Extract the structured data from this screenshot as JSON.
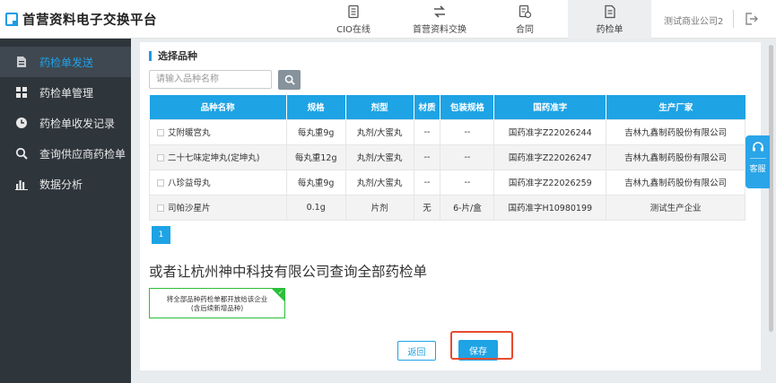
{
  "header": {
    "title": "首营资料电子交换平台",
    "tabs": [
      {
        "label": "CIO在线",
        "icon": "document-icon"
      },
      {
        "label": "首营资料交换",
        "icon": "exchange-icon"
      },
      {
        "label": "合同",
        "icon": "contract-icon"
      },
      {
        "label": "药检单",
        "icon": "report-icon"
      }
    ],
    "company": "测试商业公司2",
    "logout_icon": "logout-icon"
  },
  "sidebar": {
    "items": [
      {
        "label": "药检单发送",
        "icon": "document-icon"
      },
      {
        "label": "药检单管理",
        "icon": "grid-icon"
      },
      {
        "label": "药检单收发记录",
        "icon": "clock-icon"
      },
      {
        "label": "查询供应商药检单",
        "icon": "search-icon"
      },
      {
        "label": "数据分析",
        "icon": "bar-chart-icon"
      }
    ]
  },
  "main": {
    "section_title": "选择品种",
    "search": {
      "placeholder": "请输入品种名称",
      "value": ""
    },
    "table": {
      "columns": [
        "品种名称",
        "规格",
        "剂型",
        "材质",
        "包装规格",
        "国药准字",
        "生产厂家"
      ],
      "rows": [
        [
          "艾附暖宫丸",
          "每丸重9g",
          "丸剂/大蜜丸",
          "--",
          "--",
          "国药准字Z22026244",
          "吉林九鑫制药股份有限公司"
        ],
        [
          "二十七味定坤丸(定坤丸)",
          "每丸重12g",
          "丸剂/大蜜丸",
          "--",
          "--",
          "国药准字Z22026247",
          "吉林九鑫制药股份有限公司"
        ],
        [
          "八珍益母丸",
          "每丸重9g",
          "丸剂/大蜜丸",
          "--",
          "--",
          "国药准字Z22026259",
          "吉林九鑫制药股份有限公司"
        ],
        [
          "司帕沙星片",
          "0.1g",
          "片剂",
          "无",
          "6-片/盒",
          "国药准字H10980199",
          "测试生产企业"
        ]
      ]
    },
    "pagination": {
      "current": "1"
    },
    "alt_text": "或者让杭州神中科技有限公司查询全部药检单",
    "option": {
      "line1": "将全部品种药检单都开放给该企业",
      "line2": "(含后续新增品种)"
    },
    "back_label": "返回",
    "save_label": "保存"
  },
  "float_widget": {
    "label": "客服"
  },
  "colors": {
    "accent": "#1ea3e5",
    "sidebar_bg": "#2e353b",
    "highlight": "#e74b2e",
    "option_border": "#2bbf39"
  }
}
